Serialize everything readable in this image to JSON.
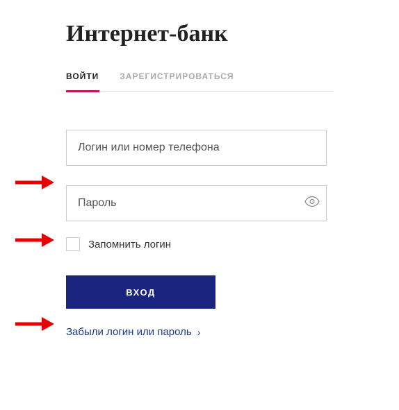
{
  "page_title": "Интернет-банк",
  "tabs": {
    "login": "ВОЙТИ",
    "register": "ЗАРЕГИСТРИРОВАТЬСЯ"
  },
  "form": {
    "login_placeholder": "Логин или номер телефона",
    "password_placeholder": "Пароль",
    "remember_label": "Запомнить логин",
    "submit_label": "ВХОД",
    "forgot_label": "Забыли логин или пароль"
  }
}
